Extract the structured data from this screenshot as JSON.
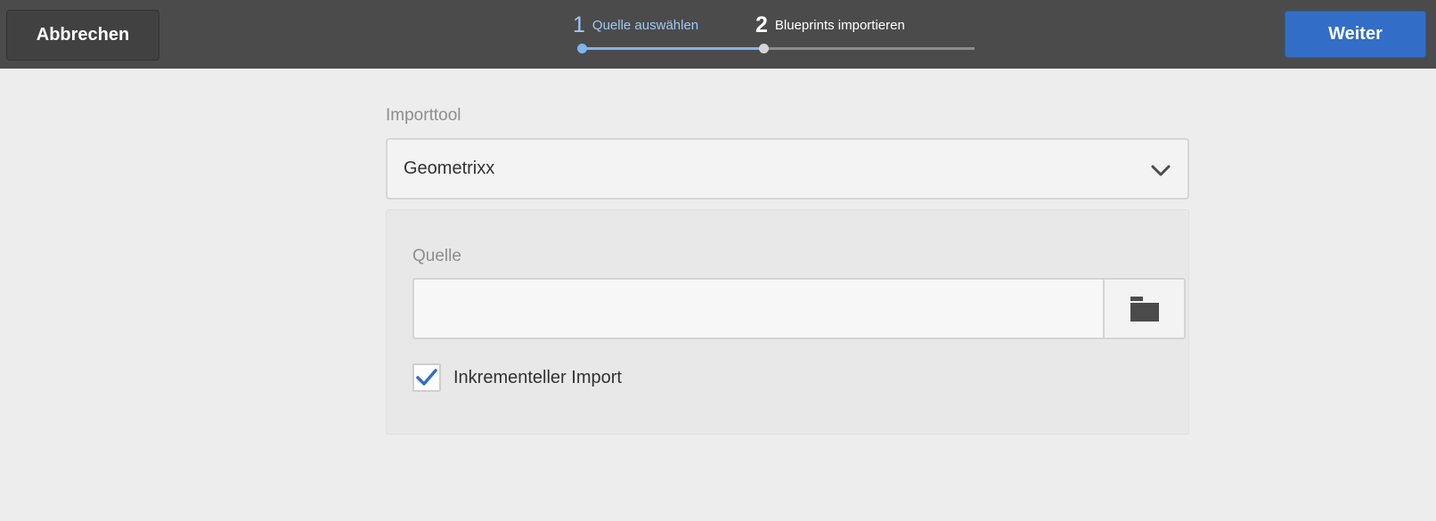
{
  "header": {
    "cancel_label": "Abbrechen",
    "next_label": "Weiter",
    "steps": [
      {
        "number": "1",
        "label": "Quelle auswählen",
        "state": "active"
      },
      {
        "number": "2",
        "label": "Blueprints importieren",
        "state": "upcoming"
      }
    ]
  },
  "form": {
    "importtool_label": "Importtool",
    "importtool_value": "Geometrixx",
    "source_label": "Quelle",
    "source_value": "",
    "incremental_label": "Inkrementeller Import",
    "incremental_checked": true
  },
  "icons": {
    "dropdown": "chevron-down-icon",
    "browse": "folder-icon",
    "checkbox": "checkmark-icon"
  },
  "colors": {
    "topbar": "#4b4b4b",
    "primary_button": "#326ec8",
    "active_step": "#7fb5ea",
    "page_background": "#ededed"
  }
}
